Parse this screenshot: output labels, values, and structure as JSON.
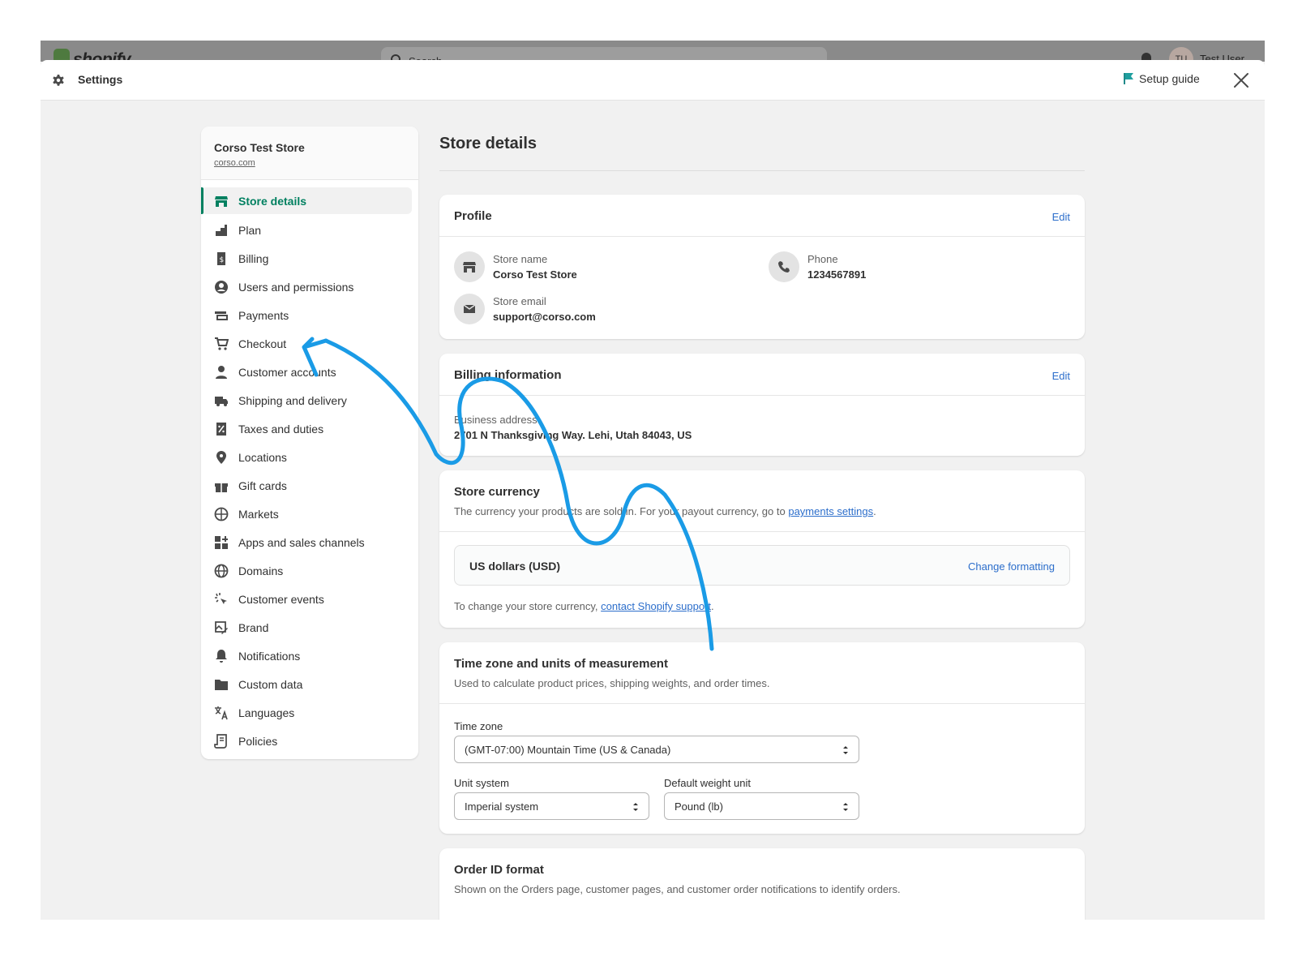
{
  "topbar": {
    "logo_text": "shopify",
    "search_placeholder": "Search",
    "avatar_initials": "TU",
    "user_name": "Test User"
  },
  "header": {
    "title": "Settings",
    "setup_guide": "Setup guide"
  },
  "sidebar": {
    "store_name": "Corso Test Store",
    "store_url": "corso.com",
    "items": [
      {
        "label": "Store details",
        "icon": "store-icon"
      },
      {
        "label": "Plan",
        "icon": "plan-icon"
      },
      {
        "label": "Billing",
        "icon": "billing-icon"
      },
      {
        "label": "Users and permissions",
        "icon": "user-circle-icon"
      },
      {
        "label": "Payments",
        "icon": "payments-icon"
      },
      {
        "label": "Checkout",
        "icon": "cart-icon"
      },
      {
        "label": "Customer accounts",
        "icon": "person-icon"
      },
      {
        "label": "Shipping and delivery",
        "icon": "truck-icon"
      },
      {
        "label": "Taxes and duties",
        "icon": "tax-icon"
      },
      {
        "label": "Locations",
        "icon": "location-pin-icon"
      },
      {
        "label": "Gift cards",
        "icon": "gift-icon"
      },
      {
        "label": "Markets",
        "icon": "globe-grid-icon"
      },
      {
        "label": "Apps and sales channels",
        "icon": "apps-icon"
      },
      {
        "label": "Domains",
        "icon": "globe-icon"
      },
      {
        "label": "Customer events",
        "icon": "cursor-sparkle-icon"
      },
      {
        "label": "Brand",
        "icon": "brand-icon"
      },
      {
        "label": "Notifications",
        "icon": "bell-icon"
      },
      {
        "label": "Custom data",
        "icon": "folder-icon"
      },
      {
        "label": "Languages",
        "icon": "translate-icon"
      },
      {
        "label": "Policies",
        "icon": "policies-icon"
      }
    ]
  },
  "main": {
    "title": "Store details",
    "profile": {
      "title": "Profile",
      "edit": "Edit",
      "store_name_label": "Store name",
      "store_name_value": "Corso Test Store",
      "phone_label": "Phone",
      "phone_value": "1234567891",
      "email_label": "Store email",
      "email_value": "support@corso.com"
    },
    "billing": {
      "title": "Billing information",
      "edit": "Edit",
      "address_label": "Business address",
      "address_value": "2701 N Thanksgiving Way. Lehi, Utah 84043, US"
    },
    "currency": {
      "title": "Store currency",
      "desc_prefix": "The currency your products are sold in. For your payout currency, go to ",
      "desc_link": "payments settings",
      "desc_suffix": ".",
      "currency_value": "US dollars (USD)",
      "change_formatting": "Change formatting",
      "footer_prefix": "To change your store currency, ",
      "footer_link": "contact Shopify support",
      "footer_suffix": "."
    },
    "timezone": {
      "title": "Time zone and units of measurement",
      "desc": "Used to calculate product prices, shipping weights, and order times.",
      "tz_label": "Time zone",
      "tz_value": "(GMT-07:00) Mountain Time (US & Canada)",
      "unit_label": "Unit system",
      "unit_value": "Imperial system",
      "weight_label": "Default weight unit",
      "weight_value": "Pound (lb)"
    },
    "order_id": {
      "title": "Order ID format",
      "desc": "Shown on the Orders page, customer pages, and customer order notifications to identify orders."
    }
  },
  "colors": {
    "accent_green": "#008060",
    "link_blue": "#2c6ecb",
    "annotation_blue": "#1a9be6"
  }
}
